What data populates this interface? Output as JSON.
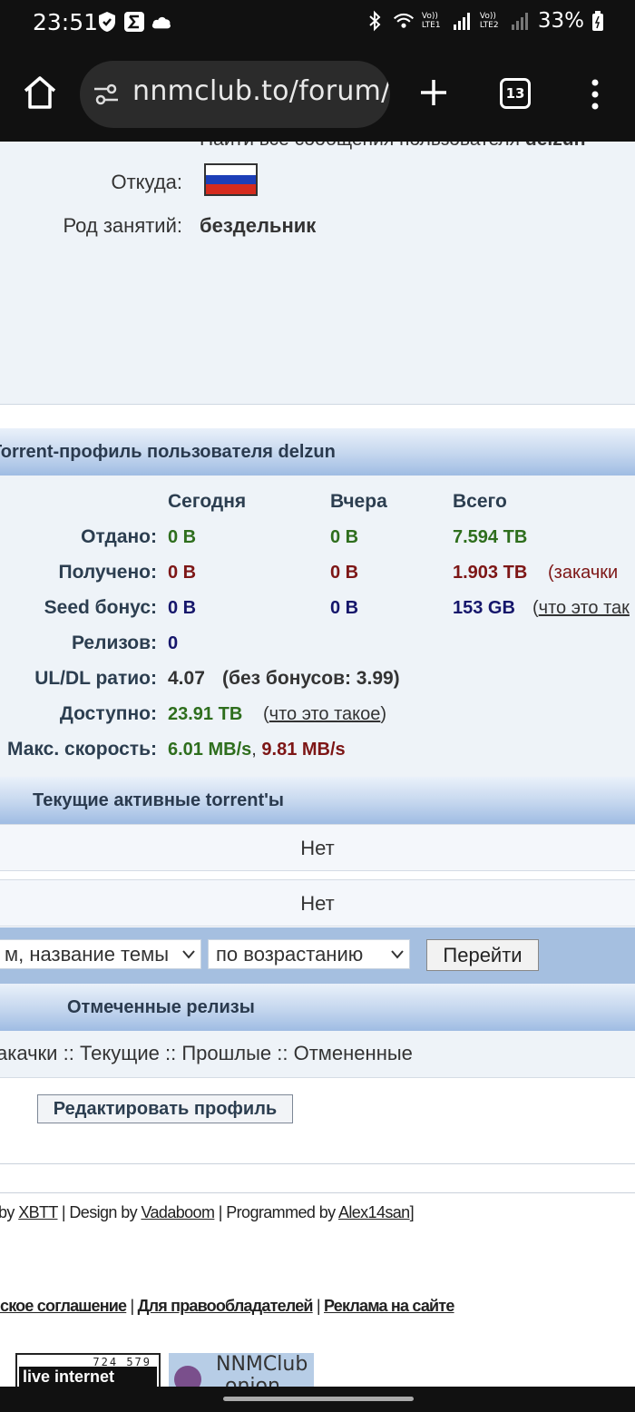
{
  "status_bar": {
    "time": "23:51",
    "battery": "33%",
    "net1": "Vo)) LTE1",
    "net2": "Vo)) LTE2",
    "icons": [
      "shield-icon",
      "sigma-icon",
      "cloud-icon",
      "bluetooth-icon",
      "wifi-icon",
      "signal-icon",
      "battery-icon"
    ]
  },
  "browser": {
    "url": "nnmclub.to/forum/",
    "tab_count": "13"
  },
  "profile": {
    "find_posts_text": "Найти все сообщения пользователя",
    "find_posts_user": "delzun",
    "from_label": "Откуда:",
    "occupation_label": "Род занятий:",
    "occupation_value": "бездельник"
  },
  "torrent_profile": {
    "header": "Torrent-профиль пользователя delzun",
    "columns": [
      "Сегодня",
      "Вчера",
      "Всего"
    ],
    "uploaded_label": "Отдано:",
    "uploaded": [
      "0 B",
      "0 B",
      "7.594 TB"
    ],
    "downloaded_label": "Получено:",
    "downloaded": [
      "0 B",
      "0 B",
      "1.903 TB"
    ],
    "downloaded_note": "(закачки",
    "seed_label": "Seed бонус:",
    "seed": [
      "0 B",
      "0 B",
      "153 GB"
    ],
    "seed_note_open": "(",
    "seed_note_link": "что это так",
    "releases_label": "Релизов:",
    "releases_value": "0",
    "ratio_label": "UL/DL ратио:",
    "ratio_value": "4.07",
    "ratio_note": "(без бонусов: 3.99)",
    "available_label": "Доступно:",
    "available_value": "23.91 TB",
    "available_note_open": "(",
    "available_note_link": "что это такое",
    "available_note_close": ")",
    "speed_label": "Макс. скорость:",
    "speed_up": "6.01 MB/s",
    "speed_sep": ",",
    "speed_down": "9.81 MB/s"
  },
  "active": {
    "header": "Текущие активные torrent'ы",
    "row1": "Нет",
    "row2": "Нет"
  },
  "sort": {
    "field_value": "м, название темы",
    "order_value": "по возрастанию",
    "go_label": "Перейти"
  },
  "marked": {
    "header": "Отмеченные релизы",
    "links": [
      "акачки",
      "Текущие",
      "Прошлые",
      "Отмененные"
    ],
    "separator": " :: "
  },
  "edit_profile_label": "Редактировать профиль",
  "footer": {
    "powered_prefix": "by",
    "powered_link": "XBTT",
    "design_prefix": "| Design by",
    "design_link": "Vadaboom",
    "programmed_prefix": "| Programmed by",
    "programmed_link": "Alex14san",
    "programmed_suffix": "]",
    "links": [
      "ское соглашение",
      "Для правообладателей",
      "Реклама на сайте"
    ],
    "sep": "|"
  },
  "badges": {
    "counter_number": "724 579",
    "counter_text": "live internet",
    "onion_title": "NNMClub",
    "onion_sub": "onion"
  }
}
